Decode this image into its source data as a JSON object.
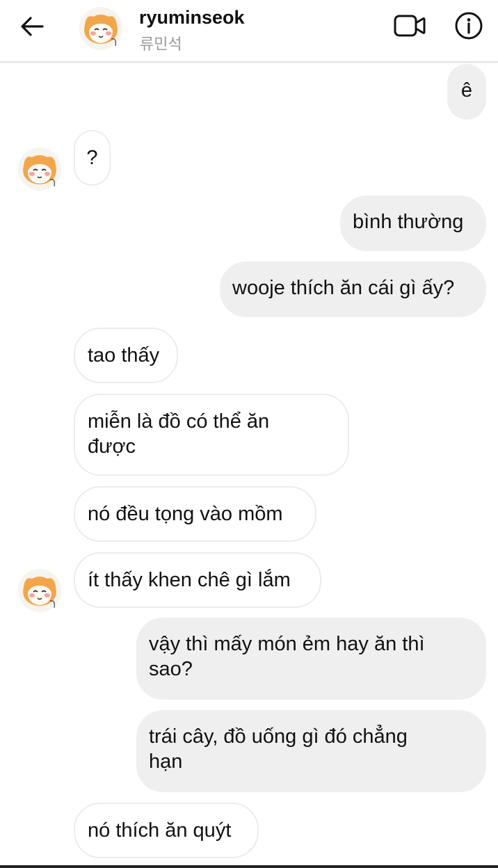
{
  "header": {
    "username": "ryuminseok",
    "subtitle": "류민석",
    "back_icon": "arrow-left-icon",
    "video_icon": "video-call-icon",
    "info_icon": "info-icon"
  },
  "messages": [
    {
      "id": 0,
      "sender": "me",
      "text": "ê"
    },
    {
      "id": 1,
      "sender": "them",
      "text": "?"
    },
    {
      "id": 2,
      "sender": "me",
      "text": "bình thường"
    },
    {
      "id": 3,
      "sender": "me",
      "text": "wooje thích ăn cái gì ấy?"
    },
    {
      "id": 4,
      "sender": "them",
      "text": "tao thấy"
    },
    {
      "id": 5,
      "sender": "them",
      "text": "miễn là đồ có thể ăn\nđược"
    },
    {
      "id": 6,
      "sender": "them",
      "text": "nó đều tọng vào mồm"
    },
    {
      "id": 7,
      "sender": "them",
      "text": "ít thấy khen chê gì lắm"
    },
    {
      "id": 8,
      "sender": "me",
      "text": "vậy thì mấy món ẻm hay ăn thì\nsao?"
    },
    {
      "id": 9,
      "sender": "me",
      "text": "trái cây, đồ uống gì đó chẳng\nhạn"
    },
    {
      "id": 10,
      "sender": "them",
      "text": "nó thích ăn quýt"
    }
  ],
  "colors": {
    "outgoing_bubble": "#efefef",
    "incoming_bubble_border": "#ececec",
    "avatar_fur": "#f2a64b"
  }
}
